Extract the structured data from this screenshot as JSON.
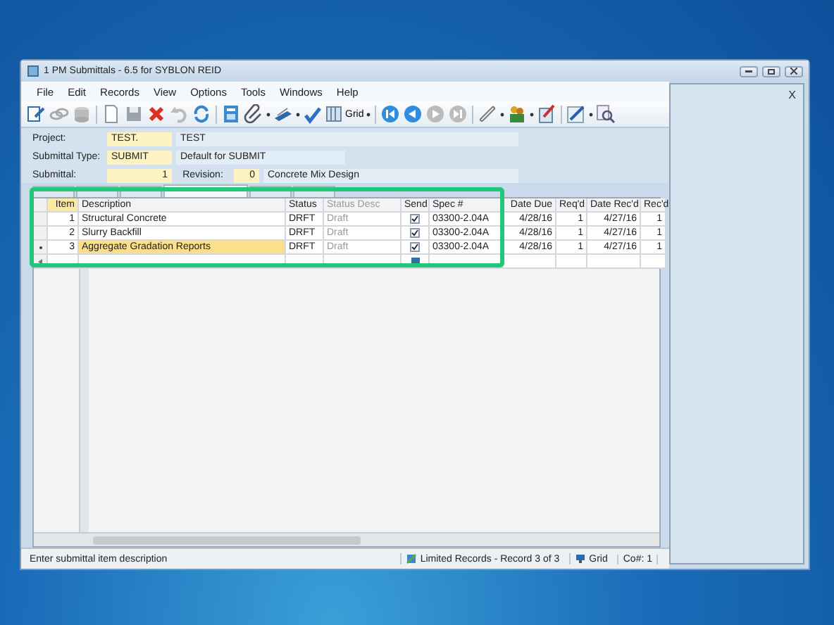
{
  "window": {
    "title": "1 PM Submittals - 6.5 for SYBLON REID"
  },
  "menu": [
    "File",
    "Edit",
    "Records",
    "View",
    "Options",
    "Tools",
    "Windows",
    "Help"
  ],
  "toolbar": {
    "view_button": "Grid"
  },
  "form": {
    "project": {
      "label": "Project:",
      "code": "TEST.",
      "name": "TEST"
    },
    "submittal_type": {
      "label": "Submittal Type:",
      "code": "SUBMIT",
      "name": "Default for SUBMIT"
    },
    "submittal": {
      "label": "Submittal:",
      "number": "1",
      "revision_label": "Revision:",
      "revision": "0",
      "title": "Concrete Mix Design"
    }
  },
  "tabs": [
    {
      "selected": false
    },
    {
      "selected": false
    },
    {
      "selected": false
    },
    {
      "selected": true
    },
    {
      "selected": false
    },
    {
      "selected": false
    }
  ],
  "grid": {
    "columns": [
      "Item",
      "Description",
      "Status",
      "Status Desc",
      "Send",
      "Spec #",
      "Date Due",
      "Req'd",
      "Date Rec'd",
      "Rec'd"
    ],
    "rows": [
      {
        "item": "1",
        "description": "Structural Concrete",
        "status": "DRFT",
        "status_desc": "Draft",
        "send": true,
        "spec": "03300-2.04A",
        "date_due": "4/28/16",
        "reqd": "1",
        "date_recd": "4/27/16",
        "recd": "1",
        "selected": false
      },
      {
        "item": "2",
        "description": "Slurry Backfill",
        "status": "DRFT",
        "status_desc": "Draft",
        "send": true,
        "spec": "03300-2.04A",
        "date_due": "4/28/16",
        "reqd": "1",
        "date_recd": "4/27/16",
        "recd": "1",
        "selected": false
      },
      {
        "item": "3",
        "description": "Aggregate Gradation Reports",
        "status": "DRFT",
        "status_desc": "Draft",
        "send": true,
        "spec": "03300-2.04A",
        "date_due": "4/28/16",
        "reqd": "1",
        "date_recd": "4/27/16",
        "recd": "1",
        "selected": true
      }
    ]
  },
  "side_panel": {
    "close": "X"
  },
  "status_bar": {
    "hint": "Enter submittal item description",
    "records": "Limited Records - Record 3 of 3",
    "view": "Grid",
    "company": "Co#: 1"
  }
}
